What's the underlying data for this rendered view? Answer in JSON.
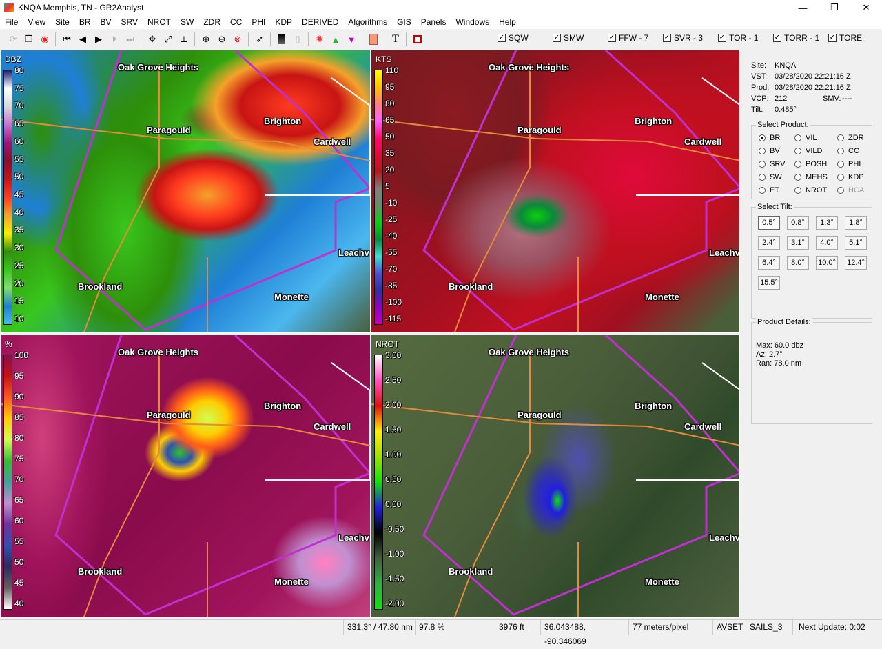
{
  "window": {
    "title": "KNQA Memphis, TN - GR2Analyst",
    "minimize": "—",
    "restore": "❐",
    "close": "✕"
  },
  "menu": [
    "File",
    "View",
    "Site",
    "BR",
    "BV",
    "SRV",
    "ZDR",
    "CC",
    "PHI",
    "KDP",
    "NROT",
    "SW",
    "ZDR",
    "CC",
    "PHI",
    "KDP",
    "DERIVED",
    "Algorithms",
    "GIS",
    "Panels",
    "Windows",
    "Help"
  ],
  "toolbar_icons": [
    "refresh-icon",
    "copy-icon",
    "globe-icon",
    "first-frame-icon",
    "prev-frame-icon",
    "play-icon",
    "next-frame-icon",
    "last-frame-icon",
    "pan-icon",
    "measure-icon",
    "cross-section-icon",
    "zoom-in-icon",
    "zoom-out-icon",
    "zoom-reset-icon",
    "cursor-icon",
    "black-icon",
    "white-icon",
    "storm-icon",
    "up-triangle-icon",
    "down-triangle-icon",
    "color-icon",
    "text-icon",
    "stop-icon"
  ],
  "warnings": [
    {
      "label": "SQW",
      "checked": true
    },
    {
      "label": "SMW",
      "checked": true
    },
    {
      "label": "FFW - 7",
      "checked": true
    },
    {
      "label": "SVR - 3",
      "checked": true
    },
    {
      "label": "TOR - 1",
      "checked": true
    },
    {
      "label": "TORR - 1",
      "checked": true
    },
    {
      "label": "TORE",
      "checked": true
    }
  ],
  "places": {
    "oak": "Oak Grove Heights",
    "paragould": "Paragould",
    "brighton": "Brighton",
    "cardwell": "Cardwell",
    "leachville": "Leachv",
    "brookland": "Brookland",
    "monette": "Monette"
  },
  "panels": {
    "reflectivity": {
      "units": "DBZ",
      "labels": [
        "80",
        "75",
        "70",
        "65",
        "60",
        "55",
        "50",
        "45",
        "40",
        "35",
        "30",
        "25",
        "20",
        "15",
        "10"
      ],
      "colors": [
        "#1a1a6e",
        "#ffffff",
        "#d9d9d9",
        "#c96fd1",
        "#a0147c",
        "#8c0d2a",
        "#c81414",
        "#ff3b1f",
        "#f5a12a",
        "#ffee00",
        "#2e8f0a",
        "#39c61d",
        "#7ee06e",
        "#1f7fd6",
        "#4bb7ee"
      ]
    },
    "velocity": {
      "units": "KTS",
      "labels": [
        "110",
        "95",
        "80",
        "65",
        "50",
        "35",
        "20",
        "5",
        "-10",
        "-25",
        "-40",
        "-55",
        "-70",
        "-85",
        "-100",
        "-115"
      ],
      "colors": [
        "#ffff00",
        "#ffc000",
        "#ff8080",
        "#ff60ff",
        "#ff0a6e",
        "#e00a3a",
        "#b01a1a",
        "#808080",
        "#6a8a6a",
        "#0ccf0c",
        "#0a8a3a",
        "#40e0d0",
        "#5050d0",
        "#3030a0",
        "#9000c0",
        "#c000c0"
      ]
    },
    "cc": {
      "units": "%",
      "labels": [
        "100",
        "95",
        "90",
        "85",
        "80",
        "75",
        "70",
        "65",
        "60",
        "55",
        "50",
        "45",
        "40"
      ],
      "colors": [
        "#8a0c4c",
        "#cc1010",
        "#ff5a1a",
        "#ffcc00",
        "#d0ff50",
        "#30c030",
        "#40a0a0",
        "#c090d0",
        "#7030a0",
        "#3050b0",
        "#2a2a60",
        "#606060",
        "#ffffff"
      ]
    },
    "nrot": {
      "units": "NROT",
      "labels": [
        "3.00",
        "2.50",
        "2.00",
        "1.50",
        "1.00",
        "0.50",
        "0.00",
        "-0.50",
        "-1.00",
        "-1.50",
        "-2.00"
      ],
      "colors": [
        "#ffffff",
        "#ff50c0",
        "#e01010",
        "#ffee00",
        "#a0e000",
        "#10e010",
        "#2020e0",
        "#000000",
        "#406040",
        "#30b040",
        "#10e010"
      ]
    }
  },
  "site_info": {
    "site_label": "Site:",
    "site": "KNQA",
    "vst_label": "VST:",
    "vst": "03/28/2020  22:21:16 Z",
    "prod_label": "Prod:",
    "prod": "03/28/2020  22:21:16 Z",
    "vcp_label": "VCP:",
    "vcp": "212",
    "smv_label": "SMV:",
    "smv": "----",
    "tilt_label": "Tilt:",
    "tilt": "0.485°"
  },
  "select_product": {
    "title": "Select Product:",
    "items": [
      {
        "label": "BR",
        "selected": true
      },
      {
        "label": "VIL"
      },
      {
        "label": "ZDR"
      },
      {
        "label": "BV"
      },
      {
        "label": "VILD"
      },
      {
        "label": "CC"
      },
      {
        "label": "SRV"
      },
      {
        "label": "POSH"
      },
      {
        "label": "PHI"
      },
      {
        "label": "SW"
      },
      {
        "label": "MEHS"
      },
      {
        "label": "KDP"
      },
      {
        "label": "ET"
      },
      {
        "label": "NROT"
      },
      {
        "label": "HCA",
        "disabled": true
      }
    ]
  },
  "select_tilt": {
    "title": "Select Tilt:",
    "items": [
      "0.5°",
      "0.8°",
      "1.3°",
      "1.8°",
      "2.4°",
      "3.1°",
      "4.0°",
      "5.1°",
      "6.4°",
      "8.0°",
      "10.0°",
      "12.4°",
      "15.5°"
    ],
    "selected": "0.5°"
  },
  "product_details": {
    "title": "Product Details:",
    "max": "Max:  60.0 dbz",
    "az": "Az:   2.7°",
    "ran": "Ran:  78.0 nm"
  },
  "status": {
    "azran": "331.3° / 47.80 nm",
    "pct": "97.8 %",
    "height": "3976 ft",
    "coords": "36.043488, -90.346069",
    "scale": "77 meters/pixel",
    "avset": "AVSET",
    "sails": "SAILS_3",
    "next": "Next Update: 0:02"
  }
}
